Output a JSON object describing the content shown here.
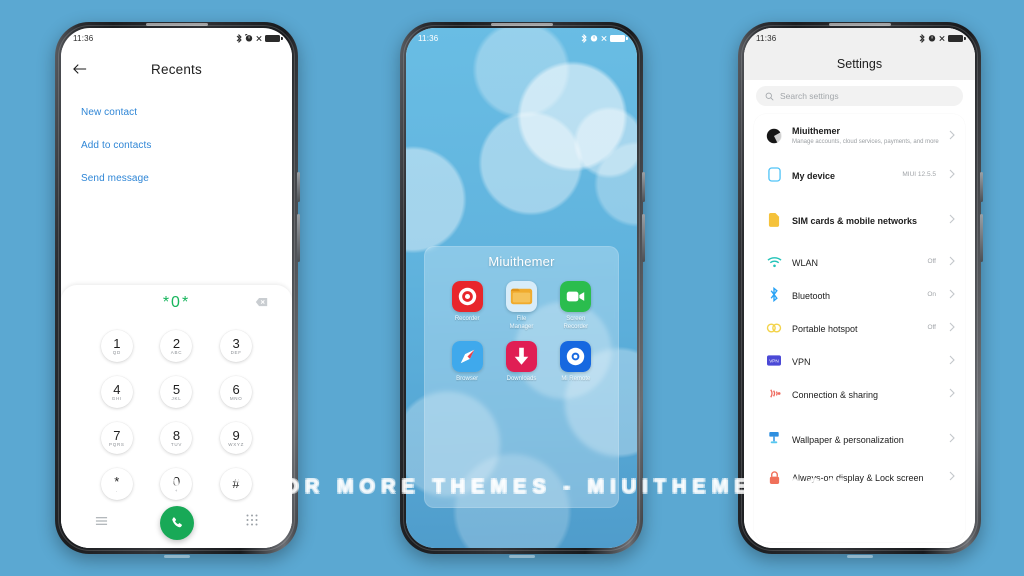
{
  "background_color": "#5ba8d2",
  "watermark": "VISIT FOR MORE THEMES - MIUITHEMER.COM",
  "status_bar": {
    "time": "11:36",
    "icons": [
      "bluetooth-icon",
      "alarm-icon",
      "mute-icon",
      "battery-icon"
    ]
  },
  "phone1": {
    "name": "dialer-recents",
    "header": {
      "title": "Recents",
      "back_icon": "arrow-left-icon"
    },
    "links": [
      "New contact",
      "Add to contacts",
      "Send message"
    ],
    "dialed_number": "*0*",
    "number_color": "#17b55c",
    "delete_icon": "backspace-icon",
    "keys": [
      {
        "digit": "1",
        "letters": "QD"
      },
      {
        "digit": "2",
        "letters": "ABC"
      },
      {
        "digit": "3",
        "letters": "DEF"
      },
      {
        "digit": "4",
        "letters": "GHI"
      },
      {
        "digit": "5",
        "letters": "JKL"
      },
      {
        "digit": "6",
        "letters": "MNO"
      },
      {
        "digit": "7",
        "letters": "PQRS"
      },
      {
        "digit": "8",
        "letters": "TUV"
      },
      {
        "digit": "9",
        "letters": "WXYZ"
      },
      {
        "digit": "*",
        "letters": "."
      },
      {
        "digit": "0",
        "letters": "+"
      },
      {
        "digit": "#",
        "letters": ""
      }
    ],
    "bottom_bar": {
      "menu_icon": "hamburger-menu-icon",
      "call_icon": "phone-call-icon",
      "call_button_color": "#18a957",
      "keypad_icon": "dialpad-icon"
    }
  },
  "phone2": {
    "name": "home-screen-folder",
    "folder_name": "Miuithemer",
    "apps": [
      {
        "label": "Recorder",
        "icon": "recorder-icon",
        "color": "#e8262b"
      },
      {
        "label": "File\nManager",
        "icon": "file-manager-icon",
        "color": "#cfe9f7"
      },
      {
        "label": "Screen\nRecorder",
        "icon": "screen-recorder-icon",
        "color": "#2bbd4e"
      },
      {
        "label": "Browser",
        "icon": "browser-compass-icon",
        "color": "#3fa9ec"
      },
      {
        "label": "Downloads",
        "icon": "downloads-icon",
        "color": "#e01e54"
      },
      {
        "label": "Mi Remote",
        "icon": "mi-remote-icon",
        "color": "#1668e0"
      }
    ]
  },
  "phone3": {
    "name": "settings",
    "title": "Settings",
    "search": {
      "placeholder": "Search settings",
      "icon": "search-icon"
    },
    "account": {
      "name": "Miuithemer",
      "subtitle": "Manage accounts, cloud services, payments, and more",
      "avatar": "user-avatar"
    },
    "items": [
      {
        "label": "My device",
        "value": "MIUI 12.5.5",
        "icon": "phone-device-icon",
        "color": "#4fc3f7",
        "bold": true
      },
      {
        "label": "SIM cards & mobile networks",
        "value": "",
        "icon": "sim-card-icon",
        "color": "#f5c23b",
        "bold": true
      },
      {
        "label": "WLAN",
        "value": "Off",
        "icon": "wifi-icon",
        "color": "#22c3b8"
      },
      {
        "label": "Bluetooth",
        "value": "On",
        "icon": "bluetooth-icon",
        "color": "#29a3f5"
      },
      {
        "label": "Portable hotspot",
        "value": "Off",
        "icon": "hotspot-icon",
        "color": "#f3d34a"
      },
      {
        "label": "VPN",
        "value": "",
        "icon": "vpn-icon",
        "color": "#4b49d6"
      },
      {
        "label": "Connection & sharing",
        "value": "",
        "icon": "connection-share-icon",
        "color": "#ef6a5e"
      },
      {
        "label": "Wallpaper & personalization",
        "value": "",
        "icon": "wallpaper-icon",
        "color": "#2f8fe0"
      },
      {
        "label": "Always-on display & Lock screen",
        "value": "",
        "icon": "lock-icon",
        "color": "#f0705a"
      }
    ],
    "chevron_icon": "chevron-right-icon"
  }
}
